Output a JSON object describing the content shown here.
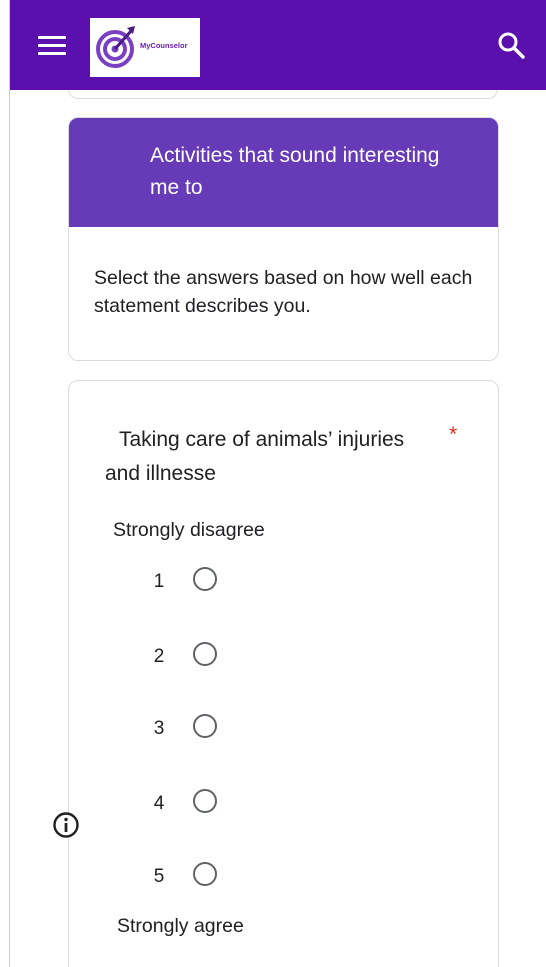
{
  "header": {
    "brand": "MyCounselor",
    "bar_color": "#5b0fac"
  },
  "section": {
    "title": "Activities that sound interesting me to",
    "description": "Select the answers based on how well each statement describes you.",
    "header_color": "#673ab7"
  },
  "question": {
    "title": "Taking care of animals’ injuries and illnesse",
    "required_mark": "*",
    "low_label": "Strongly disagree",
    "high_label": "Strongly agree",
    "options": [
      "1",
      "2",
      "3",
      "4",
      "5"
    ],
    "selected": null
  },
  "icons": {
    "menu": "hamburger-menu-icon",
    "search": "search-icon",
    "logo": "target-arrow-logo",
    "info": "info-icon"
  }
}
